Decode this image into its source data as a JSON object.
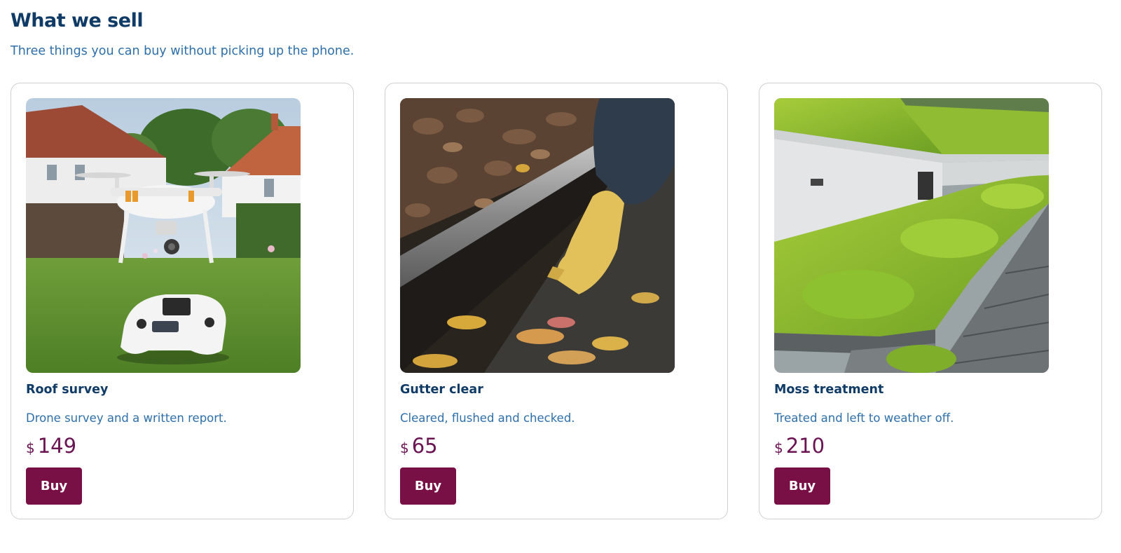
{
  "section": {
    "title": "What we sell",
    "subtitle": "Three things you can buy without picking up the phone."
  },
  "products": [
    {
      "name": "Roof survey",
      "description": "Drone survey and a written report.",
      "currency": "$",
      "price": "149",
      "buy_label": "Buy",
      "image": "drone-and-controller-on-lawn"
    },
    {
      "name": "Gutter clear",
      "description": "Cleared, flushed and checked.",
      "currency": "$",
      "price": "65",
      "buy_label": "Buy",
      "image": "gloved-hand-clearing-leaves-from-gutter"
    },
    {
      "name": "Moss treatment",
      "description": "Treated and left to weather off.",
      "currency": "$",
      "price": "210",
      "buy_label": "Buy",
      "image": "moss-covered-roof-tiles"
    }
  ],
  "colors": {
    "heading": "#0f3b66",
    "body_text": "#2f6fa9",
    "price": "#6b1453",
    "button": "#781046",
    "card_border": "#d0d0d0"
  }
}
